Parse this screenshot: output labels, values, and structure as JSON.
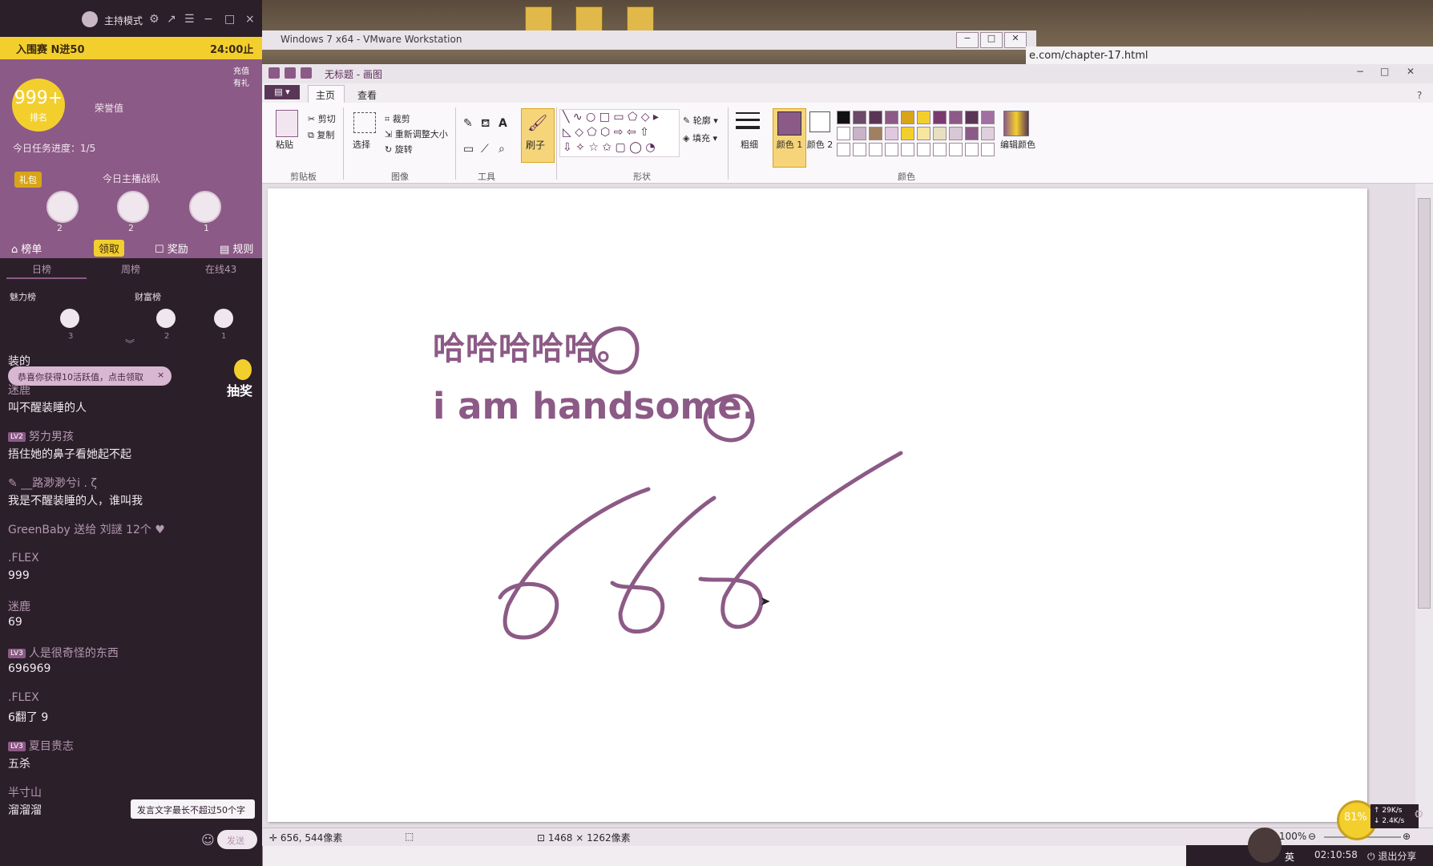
{
  "stream_panel": {
    "host_mode": "主持模式",
    "yellow_bar_left": "入围赛 N进50",
    "yellow_bar_right": "24:00止",
    "badge_number": "999+",
    "badge_sub": "排名",
    "honor": "荣誉值",
    "gift_label": "充值 有礼",
    "task_progress": "今日任务进度：1/5",
    "sign_in": "礼包",
    "team_title": "今日主播战队",
    "team_counts": [
      "2",
      "2",
      "1"
    ],
    "tabs": {
      "board": "榜单",
      "collect": "领取",
      "reward": "奖励",
      "rules": "规则"
    },
    "rank_tabs": [
      "日榜",
      "周榜",
      "在线43"
    ],
    "charm_rank": "魅力榜",
    "wealth_rank": "财富榜",
    "small_counts": [
      "3",
      "2",
      "1"
    ],
    "pill_text": "恭喜你获得10活跃值，点击领取",
    "pill_close": "×",
    "lottery": "抽奖",
    "partial_top": "装的",
    "comments": [
      {
        "name": "迷鹿",
        "level": "",
        "msg": "叫不醒装睡的人"
      },
      {
        "name": "努力男孩",
        "level": "LV2",
        "msg": "捂住她的鼻子看她起不起"
      },
      {
        "name": "__路渺渺兮i . ζ",
        "level": "",
        "msg": "我是不醒装睡的人，谁叫我"
      },
      {
        "name": "GreenBaby 送给 刘謎 12个",
        "level": "",
        "msg": ""
      },
      {
        "name": ".FLEX",
        "level": "",
        "msg": "999"
      },
      {
        "name": "迷鹿",
        "level": "",
        "msg": "69"
      },
      {
        "name": "人是很奇怪的东西",
        "level": "LV3",
        "msg": "696969"
      },
      {
        "name": ".FLEX",
        "level": "",
        "msg": "6翻了 9"
      },
      {
        "name": "夏目贵志",
        "level": "LV3",
        "msg": "五杀"
      },
      {
        "name": "半寸山",
        "level": "",
        "msg": "溜溜溜"
      }
    ],
    "tooltip": "发言文字最长不超过50个字",
    "send": "发送"
  },
  "vmware": {
    "title": "Windows 7 x64 - VMware Workstation",
    "url_fragment": "e.com/chapter-17.html"
  },
  "paint": {
    "title": "无标题 - 画图",
    "file_tab": "▾",
    "tabs": [
      "主页",
      "查看"
    ],
    "clipboard": {
      "paste": "粘贴",
      "cut": "剪切",
      "copy": "复制",
      "label": "剪贴板"
    },
    "image": {
      "select": "选择",
      "crop": "裁剪",
      "resize": "重新调整大小",
      "rotate": "旋转",
      "label": "图像"
    },
    "tools": {
      "label": "工具"
    },
    "brush": "刷子",
    "shapes": {
      "outline": "轮廓",
      "fill": "填充",
      "label": "形状"
    },
    "size": "粗细",
    "color1": "颜色 1",
    "color2": "颜色 2",
    "colors_label": "颜色",
    "edit_colors": "编辑颜色",
    "canvas_text_1": "哈哈哈哈哈。",
    "canvas_text_2": "i am handsome.",
    "status_pos": "656, 544像素",
    "status_size": "1468 × 1262像素",
    "zoom": "100%",
    "colors": {
      "accent": "#8c5a86",
      "yellow": "#f3cf2e"
    }
  },
  "taskbar": {
    "net_pct": "81%",
    "net_up": "29K/s",
    "net_down": "2.4K/s",
    "lang": "英",
    "time": "02:10:58",
    "exit_share": "退出分享"
  }
}
